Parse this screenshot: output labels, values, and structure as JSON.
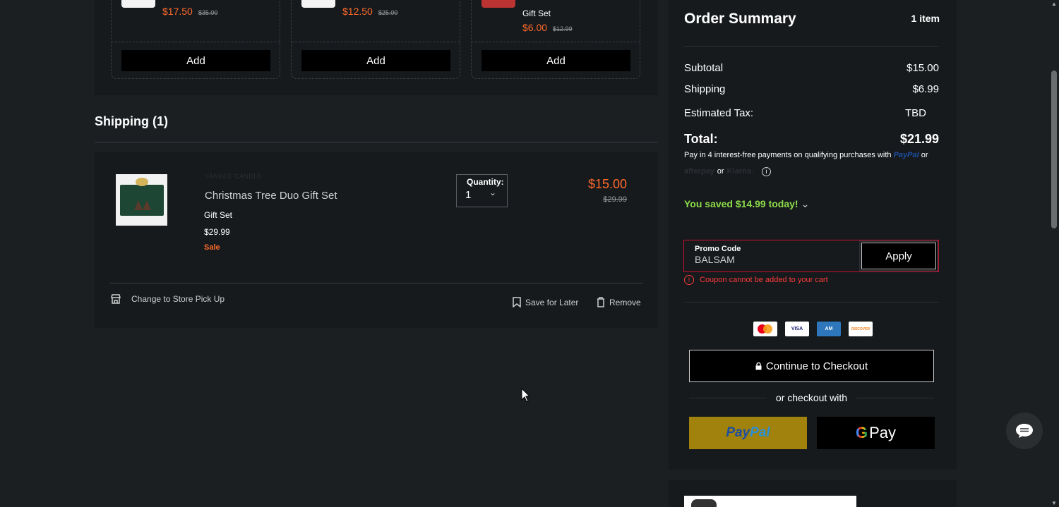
{
  "recommendations": [
    {
      "price": "$17.50",
      "orig": "$35.00",
      "sub": "",
      "add_label": "Add"
    },
    {
      "price": "$12.50",
      "orig": "$25.00",
      "sub": "",
      "add_label": "Add"
    },
    {
      "price": "$6.00",
      "orig": "$12.99",
      "sub": "Gift Set",
      "add_label": "Add"
    }
  ],
  "shipping": {
    "title": "Shipping (1)",
    "item": {
      "brand": "YANKEE CANDLE",
      "name": "Christmas Tree Duo Gift Set",
      "type": "Gift Set",
      "list_price": "$29.99",
      "sale_label": "Sale",
      "quantity_label": "Quantity:",
      "quantity_value": "1",
      "price": "$15.00",
      "orig_price": "$29.99"
    },
    "actions": {
      "store_pickup": "Change to Store Pick Up",
      "save_later": "Save for Later",
      "remove": "Remove"
    }
  },
  "summary": {
    "title": "Order Summary",
    "count": "1 item",
    "subtotal_label": "Subtotal",
    "subtotal_value": "$15.00",
    "shipping_label": "Shipping",
    "shipping_value": "$6.99",
    "tax_label": "Estimated Tax:",
    "tax_value": "TBD",
    "total_label": "Total:",
    "total_value": "$21.99",
    "pay_msg": "Pay in 4 interest-free payments on qualifying purchases with",
    "paypal_word": "PayPal",
    "or1": "or",
    "afterpay_word": "afterpay",
    "or2": "or",
    "klarna_word": "Klarna.",
    "info_glyph": "i",
    "saved": "You saved $14.99 today!",
    "promo_label": "Promo Code",
    "promo_value": "BALSAM",
    "apply_label": "Apply",
    "error": "Coupon cannot be added to your cart",
    "cards": {
      "visa": "VISA",
      "amex": "AM",
      "discover": "DISCOVER"
    },
    "checkout_label": "Continue to Checkout",
    "or_checkout": "or checkout with",
    "paypal_btn": {
      "p1": "Pay",
      "p2": "Pal"
    },
    "gpay": {
      "g": "G",
      "pay": "Pay"
    }
  },
  "colors": {
    "accent": "#ff6a2b",
    "saved": "#8fdd4a",
    "error": "#ff3b3b",
    "background": "#1b1f22"
  }
}
